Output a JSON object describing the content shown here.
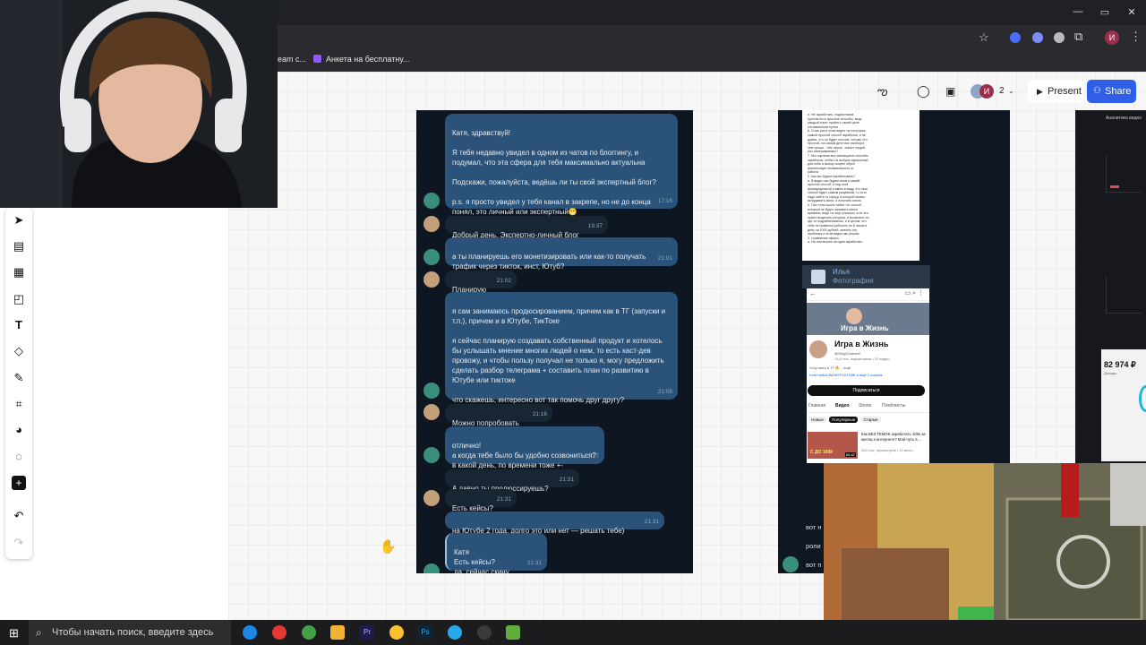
{
  "bookmarks": {
    "items": [
      {
        "label": "eam c..."
      },
      {
        "label": "Анкета на бесплатну..."
      }
    ]
  },
  "header": {
    "collaborators_count": "2",
    "avatar_letter": "И",
    "present_label": "Present",
    "share_label": "Share"
  },
  "chat": {
    "messages": [
      {
        "side": "out",
        "text": "Катя, здравствуй!\n\nЯ тебя недавно увидел в одном из чатов по блоггингу, и подумал, что эта сфера для тебя максимально актуальна\n\nПодскажи, пожалуйста, ведёшь ли ты свой экспертный блог?\n\np.s. я просто увидел у тебя канал в закрепе, но не до конца понял, это личный или экспертный😁",
        "time": "17:16"
      },
      {
        "side": "in",
        "text": "Добрый день. Экспертно-личный блог",
        "time": "19:37"
      },
      {
        "side": "out",
        "text": "а ты планируешь его монетизировать или как-то получать трафик через тикток, инст, Ютуб?",
        "time": "21:01"
      },
      {
        "side": "in",
        "text": "Планирую",
        "time": "21:02"
      },
      {
        "side": "out",
        "text": "я сам занимаюсь продюсированием, причем как в ТГ (запуски и т.п.), причем и в Ютубе, ТикТоке\n\nя сейчас планирую создавать собственный продукт и хотелось бы услышать мнение многих людей о нем, то есть каст-дев провожу, и чтобы пользу получал не только я, могу предложить сделать разбор телеграма + составить план по развитию в Ютубе или тиктоке\n\nчто скажешь, интересно вот так помочь друг другу?",
        "time": "21:08"
      },
      {
        "side": "in",
        "text": "Можно попробовать",
        "time": "21:16"
      },
      {
        "side": "out",
        "text": "отлично!\nа когда тебе было бы удобно созвониться?\nв какой день, по времени тоже +-",
        "time": "21:27"
      },
      {
        "side": "in",
        "text": "А давно ты продюссируешь?",
        "time": "21:31"
      },
      {
        "side": "in",
        "text": "Есть кейсы?",
        "time": "21:31"
      },
      {
        "side": "out",
        "text": "на Ютубе 2 года, долго это или нет — решать тебе)",
        "time": "21:31"
      },
      {
        "side": "out",
        "text": "Катя\nЕсть кейсы?\nда, сейчас скину",
        "time": "21:31"
      }
    ]
  },
  "doc": {
    "text": "и. Не заработать, подписчиков,\nпричем есть простые способы, ведь\nкаждый хочет прийти к своей цели\nоптимальным путем\n6. И как раз в этом видео ты получишь\nсамый простой способ заработка, и не\nдумая, что он будет плохим, потому что\nпростой, на самом деле все наоборот,\nчем проще - тем лучше, значит людей\nраз измеримаемых?\n7. Мы оценили все имеющиеся способы\nзаработка, чтобы ты выбрал идеальный\nдля себя и моему скорее обрел\nфинансовую независимость от\nработы\n2. Как мы будем зарабатывать?\na. В видео мы будем искать самый\nпростой способ, и под этой\nформулировкой я имею в виду, что наш\nспособ будет самым разумным, то есть\nнадо найти ту сферу, в которой можно\nвкладывать мало, а получать много\nb. При этом нужно найти тот способ,\nкоторый не будет занимать много\nвремени, ведь ты еще учишься, а не это\nнужно выделять ресурсы, и возможно ты\nгде-то подрабатываешь, и в целом, что\nтебе не нравится работать по 8 часов в\nдень за 1000 рублей, именно эту\nпроблему и этом видео мы решим\n3. Сравнение сферы\na. На чем можно сегодня заработать"
  },
  "yt_card": {
    "sender": "Илья",
    "caption": "Фотография",
    "banner_title": "Игра в Жизнь",
    "channel_name": "Игра в Жизнь",
    "handle": "@OlegChaeeeff",
    "stats": "13,8 тыс. подписчиков • 31 видео",
    "about": "Хочу жить в ТГ 🔥 ...ещё",
    "link": "t.me/+aNdL3M28YP11OTM6 и ещё 1 ссылка",
    "subscribe": "Подписаться",
    "tabs": [
      "Главная",
      "Видео",
      "Shorts",
      "Плейлисты"
    ],
    "chips": [
      "Новые",
      "Популярные",
      "Старые"
    ],
    "video_title": "Как БЕЗ ТЕМОК заработать 100к за месяц в интернете? Мой путь в ...",
    "video_meta": "264 тыс. просмотров • 11 меся...",
    "thumb_text": "С ДО 100К",
    "duration": "22:47",
    "peek_lines": [
      "вот н",
      "роли",
      "вот п"
    ]
  },
  "far_right": {
    "title": "Аналитика видео",
    "amount": "82 974 ₽",
    "amount_label": "Доходы"
  },
  "taskbar": {
    "search_placeholder": "Чтобы начать поиск, введите здесь"
  },
  "colors": {
    "accent": "#2f5ee8",
    "chat_bg": "#0e1621",
    "bubble_out": "#2b5278",
    "bubble_in": "#182533"
  }
}
